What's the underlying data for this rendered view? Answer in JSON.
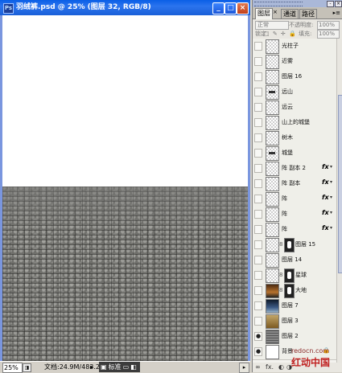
{
  "document": {
    "title": "羽绒裤.psd @ 25% (图层 32, RGB/8)",
    "status": {
      "zoom": "25%",
      "doc_size": "文档:24.9M/483.2M",
      "arrow": "▸",
      "tray_label": "标准",
      "tray_icons": [
        "▣",
        "▭",
        "◧",
        "▸"
      ]
    }
  },
  "layers_panel": {
    "tabs": [
      {
        "label": "图层",
        "active": true
      },
      {
        "label": "通道",
        "active": false
      },
      {
        "label": "路径",
        "active": false
      }
    ],
    "blend_mode": "正常",
    "opacity_label": "不透明度:",
    "opacity_value": "100%",
    "lock_label": "锁定:",
    "lock_icons": "□ ✎ ✛ 🔒",
    "fill_label": "填充:",
    "fill_value": "100%",
    "layers": [
      {
        "name": "光柱子",
        "visible": false,
        "thumb": "checker",
        "mask": false,
        "fx": false
      },
      {
        "name": "近雾",
        "visible": false,
        "thumb": "checker",
        "mask": false,
        "fx": false
      },
      {
        "name": "图层 16",
        "visible": false,
        "thumb": "checker",
        "mask": false,
        "fx": false
      },
      {
        "name": "远山",
        "visible": false,
        "thumb": "checker-mark",
        "mask": false,
        "fx": false
      },
      {
        "name": "远云",
        "visible": false,
        "thumb": "checker",
        "mask": false,
        "fx": false
      },
      {
        "name": "山上的城堡",
        "visible": false,
        "thumb": "checker",
        "mask": false,
        "fx": false
      },
      {
        "name": "树木",
        "visible": false,
        "thumb": "checker",
        "mask": false,
        "fx": false
      },
      {
        "name": "城堡",
        "visible": false,
        "thumb": "checker-mark",
        "mask": false,
        "fx": false
      },
      {
        "name": "阵 副本 2",
        "visible": false,
        "thumb": "checker",
        "mask": false,
        "fx": true
      },
      {
        "name": "阵 副本",
        "visible": false,
        "thumb": "checker",
        "mask": false,
        "fx": true
      },
      {
        "name": "阵",
        "visible": false,
        "thumb": "checker",
        "mask": false,
        "fx": true
      },
      {
        "name": "阵",
        "visible": false,
        "thumb": "checker",
        "mask": false,
        "fx": true
      },
      {
        "name": "阵",
        "visible": false,
        "thumb": "checker",
        "mask": false,
        "fx": true
      },
      {
        "name": "图层 15",
        "visible": false,
        "thumb": "checker",
        "mask": true,
        "fx": false
      },
      {
        "name": "图层 14",
        "visible": false,
        "thumb": "checker",
        "mask": false,
        "fx": false
      },
      {
        "name": "星球",
        "visible": false,
        "thumb": "checker",
        "mask": true,
        "fx": false
      },
      {
        "name": "大地",
        "visible": false,
        "thumb": "land",
        "mask": true,
        "fx": false
      },
      {
        "name": "图层 7",
        "visible": false,
        "thumb": "sky",
        "mask": false,
        "fx": false
      },
      {
        "name": "图层 3",
        "visible": false,
        "thumb": "gold",
        "mask": false,
        "fx": false
      },
      {
        "name": "图层 2",
        "visible": true,
        "thumb": "stones",
        "mask": false,
        "fx": false
      },
      {
        "name": "背景",
        "visible": true,
        "thumb": "white",
        "mask": false,
        "fx": false,
        "locked": true
      }
    ],
    "fx_label": "fx",
    "footer_icons": [
      "∞",
      "fx.",
      "◐",
      "◑",
      "▭",
      "▣",
      "🗑"
    ]
  },
  "watermark": {
    "site": "redocn.com",
    "name": "红动中国"
  }
}
